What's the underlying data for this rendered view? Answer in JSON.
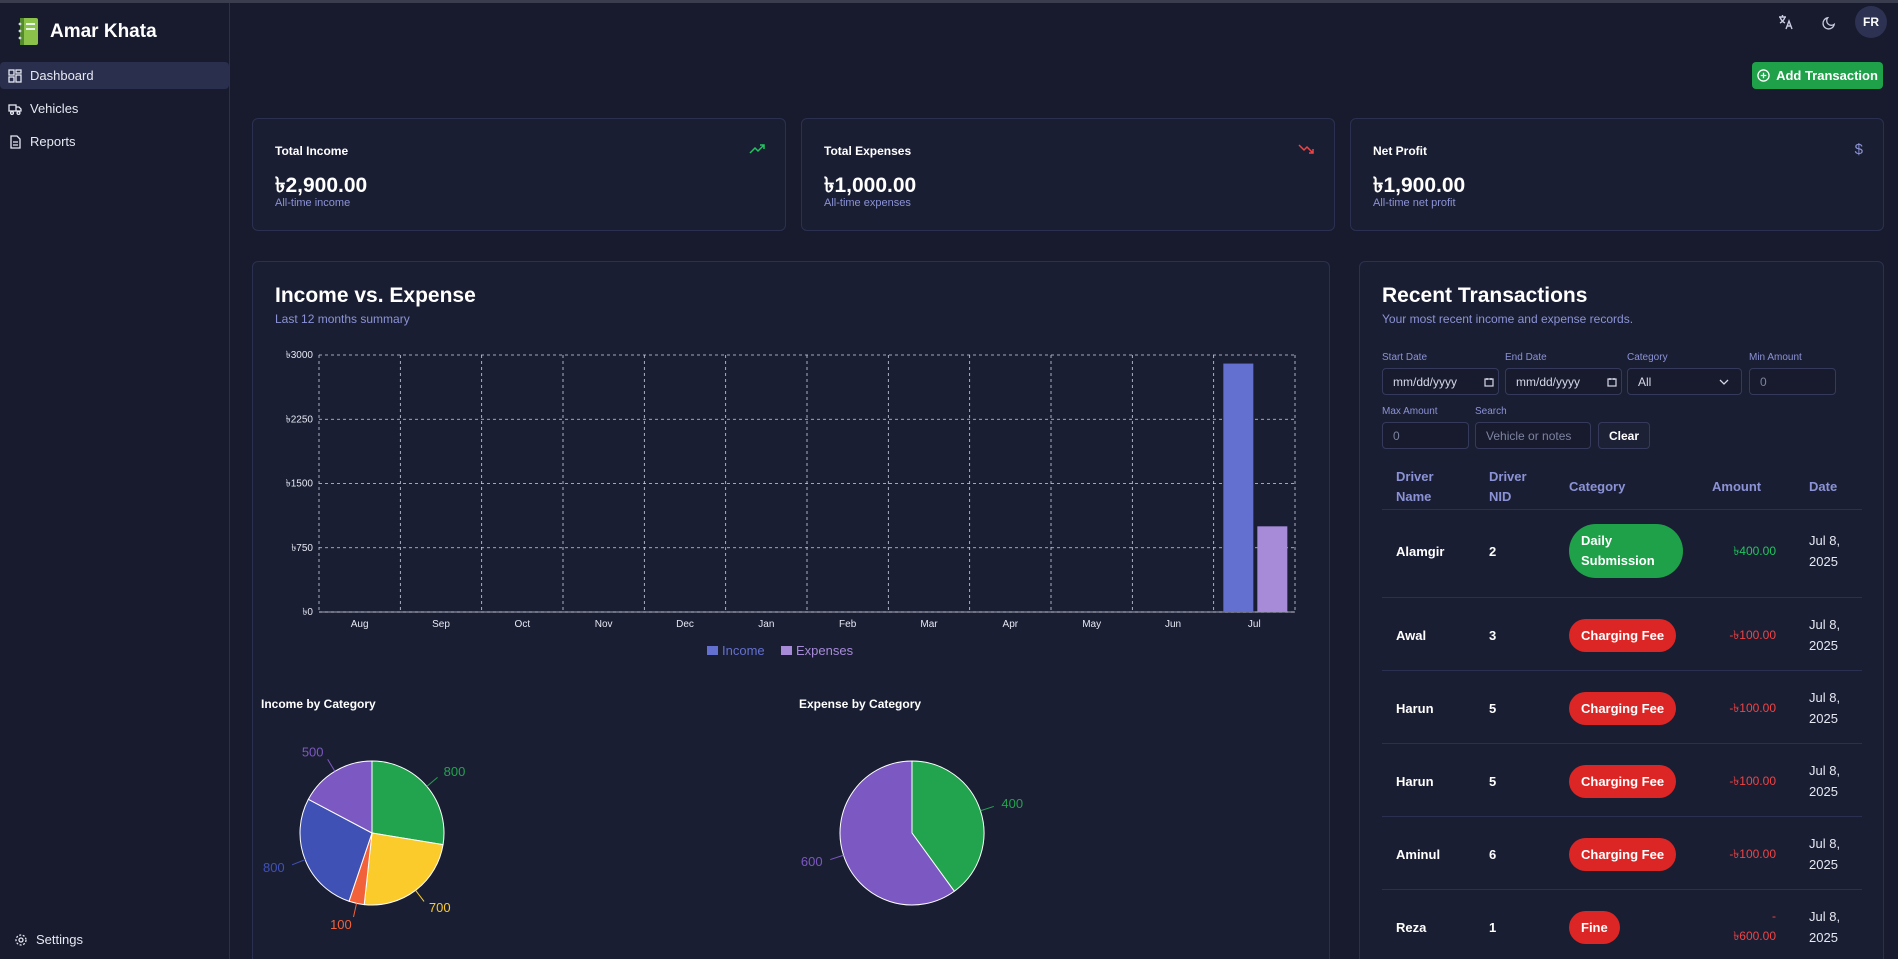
{
  "app": {
    "name": "Amar Khata"
  },
  "sidebar": {
    "items": [
      {
        "label": "Dashboard",
        "icon": "dashboard-icon"
      },
      {
        "label": "Vehicles",
        "icon": "truck-icon"
      },
      {
        "label": "Reports",
        "icon": "report-icon"
      }
    ],
    "settings_label": "Settings"
  },
  "header": {
    "avatar_initials": "FR",
    "add_transaction_label": "Add Transaction"
  },
  "stats": [
    {
      "title": "Total Income",
      "value": "৳2,900.00",
      "subtitle": "All-time income",
      "icon": "trend-up-icon",
      "color": "#22c55e"
    },
    {
      "title": "Total Expenses",
      "value": "৳1,000.00",
      "subtitle": "All-time expenses",
      "icon": "trend-down-icon",
      "color": "#ef4444"
    },
    {
      "title": "Net Profit",
      "value": "৳1,900.00",
      "subtitle": "All-time net profit",
      "icon": "dollar-icon",
      "color": "#8b93d6"
    }
  ],
  "income_expense": {
    "title": "Income vs. Expense",
    "subtitle": "Last 12 months summary"
  },
  "pies": {
    "income_title": "Income by Category",
    "expense_title": "Expense by Category"
  },
  "chart_data": [
    {
      "type": "bar",
      "categories": [
        "Aug",
        "Sep",
        "Oct",
        "Nov",
        "Dec",
        "Jan",
        "Feb",
        "Mar",
        "Apr",
        "May",
        "Jun",
        "Jul"
      ],
      "series": [
        {
          "name": "Income",
          "color": "#6370cf",
          "values": [
            0,
            0,
            0,
            0,
            0,
            0,
            0,
            0,
            0,
            0,
            0,
            2900
          ]
        },
        {
          "name": "Expenses",
          "color": "#a78bd9",
          "values": [
            0,
            0,
            0,
            0,
            0,
            0,
            0,
            0,
            0,
            0,
            0,
            1000
          ]
        }
      ],
      "yticks": [
        "৳0",
        "৳750",
        "৳1500",
        "৳2250",
        "৳3000"
      ],
      "ylim": [
        0,
        3000
      ],
      "grid": true,
      "legend": "bottom-center"
    },
    {
      "type": "pie",
      "values": [
        800,
        700,
        100,
        800,
        500
      ],
      "colors": [
        "#22a34d",
        "#fbcb2b",
        "#f2623a",
        "#3f51b5",
        "#7c58c2"
      ],
      "labels": [
        "800",
        "700",
        "100",
        "800",
        "500"
      ]
    },
    {
      "type": "pie",
      "values": [
        400,
        600
      ],
      "colors": [
        "#22a34d",
        "#7c58c2"
      ],
      "labels": [
        "400",
        "600"
      ]
    }
  ],
  "transactions": {
    "title": "Recent Transactions",
    "subtitle": "Your most recent income and expense records.",
    "filters": {
      "start_date_label": "Start Date",
      "start_date_value": "mm/dd/yyyy",
      "end_date_label": "End Date",
      "end_date_value": "mm/dd/yyyy",
      "category_label": "Category",
      "category_value": "All",
      "min_amount_label": "Min Amount",
      "min_amount_placeholder": "0",
      "max_amount_label": "Max Amount",
      "max_amount_placeholder": "0",
      "search_label": "Search",
      "search_placeholder": "Vehicle or notes",
      "clear_label": "Clear"
    },
    "columns": {
      "driver_name_1": "Driver",
      "driver_name_2": "Name",
      "driver_nid_1": "Driver",
      "driver_nid_2": "NID",
      "category": "Category",
      "amount": "Amount",
      "date": "Date"
    },
    "rows": [
      {
        "name": "Alamgir",
        "nid": "2",
        "category_1": "Daily",
        "category_2": "Submission",
        "amount": "৳400.00",
        "amount_color": "#22c55e",
        "date_1": "Jul 8,",
        "date_2": "2025",
        "badge_color": "#1fa14a"
      },
      {
        "name": "Awal",
        "nid": "3",
        "category_1": "Charging Fee",
        "category_2": "",
        "amount": "-৳100.00",
        "amount_color": "#ef4444",
        "date_1": "Jul 8,",
        "date_2": "2025",
        "badge_color": "#dc2626"
      },
      {
        "name": "Harun",
        "nid": "5",
        "category_1": "Charging Fee",
        "category_2": "",
        "amount": "-৳100.00",
        "amount_color": "#ef4444",
        "date_1": "Jul 8,",
        "date_2": "2025",
        "badge_color": "#dc2626"
      },
      {
        "name": "Harun",
        "nid": "5",
        "category_1": "Charging Fee",
        "category_2": "",
        "amount": "-৳100.00",
        "amount_color": "#ef4444",
        "date_1": "Jul 8,",
        "date_2": "2025",
        "badge_color": "#dc2626"
      },
      {
        "name": "Aminul",
        "nid": "6",
        "category_1": "Charging Fee",
        "category_2": "",
        "amount": "-৳100.00",
        "amount_color": "#ef4444",
        "date_1": "Jul 8,",
        "date_2": "2025",
        "badge_color": "#dc2626"
      },
      {
        "name": "Reza",
        "nid": "1",
        "category_1": "Fine",
        "category_2": "",
        "amount_1": "-",
        "amount_2": "৳600.00",
        "amount_color": "#ef4444",
        "date_1": "Jul 8,",
        "date_2": "2025",
        "badge_color": "#dc2626"
      }
    ]
  }
}
